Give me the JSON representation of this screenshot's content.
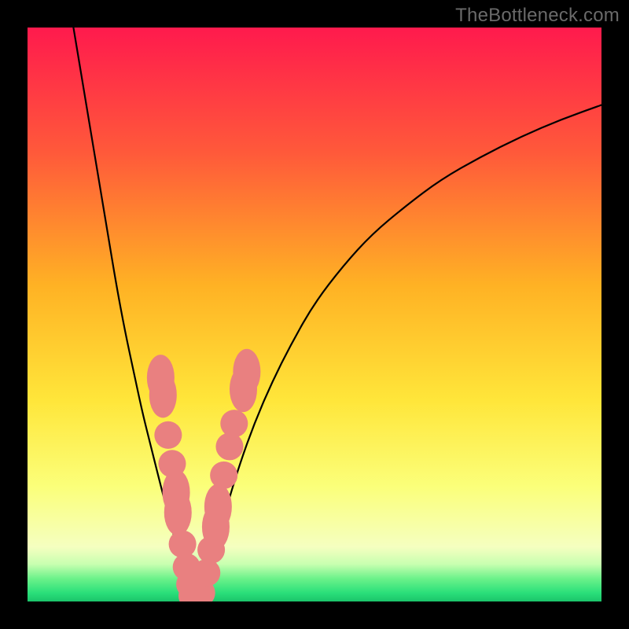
{
  "watermark": "TheBottleneck.com",
  "chart_data": {
    "type": "line",
    "title": "",
    "xlabel": "",
    "ylabel": "",
    "xlim": [
      0,
      100
    ],
    "ylim": [
      0,
      100
    ],
    "grid": false,
    "legend": false,
    "background_gradient_stops": [
      {
        "offset": 0.0,
        "color": "#ff1a4d"
      },
      {
        "offset": 0.22,
        "color": "#ff5a3a"
      },
      {
        "offset": 0.45,
        "color": "#ffb224"
      },
      {
        "offset": 0.65,
        "color": "#ffe63a"
      },
      {
        "offset": 0.8,
        "color": "#fbff7a"
      },
      {
        "offset": 0.905,
        "color": "#f5ffc0"
      },
      {
        "offset": 0.935,
        "color": "#c8ffb0"
      },
      {
        "offset": 0.96,
        "color": "#6cf28a"
      },
      {
        "offset": 0.985,
        "color": "#2adf7a"
      },
      {
        "offset": 1.0,
        "color": "#1bc46a"
      }
    ],
    "series": [
      {
        "name": "left-branch",
        "color": "#000000",
        "stroke_width": 2.2,
        "x": [
          8.0,
          9.5,
          11.0,
          12.5,
          14.0,
          15.5,
          17.0,
          18.5,
          20.0,
          21.5,
          23.0,
          24.3,
          25.5,
          26.5,
          27.3,
          28.0,
          28.7
        ],
        "y": [
          100,
          91.0,
          82.0,
          73.0,
          64.0,
          55.0,
          47.0,
          40.0,
          33.0,
          27.0,
          21.0,
          16.0,
          11.5,
          7.5,
          4.5,
          2.2,
          1.0
        ]
      },
      {
        "name": "right-branch",
        "color": "#000000",
        "stroke_width": 2.2,
        "x": [
          29.5,
          30.5,
          32.0,
          33.5,
          35.0,
          37.0,
          39.5,
          42.5,
          46.0,
          50.0,
          55.0,
          60.0,
          66.0,
          72.0,
          79.0,
          86.0,
          93.0,
          100.0
        ],
        "y": [
          1.0,
          3.0,
          7.0,
          12.0,
          17.5,
          24.0,
          31.0,
          38.0,
          45.0,
          52.0,
          58.5,
          64.0,
          69.0,
          73.5,
          77.5,
          81.0,
          84.0,
          86.5
        ]
      }
    ],
    "v_bottom": {
      "x_start": 28.7,
      "x_end": 29.5,
      "y": 1.0
    },
    "marker_groups": [
      {
        "name": "left-branch-markers",
        "color": "#e98080",
        "points": [
          {
            "x": 23.2,
            "y": 39.0,
            "rx": 2.4,
            "ry": 4.0
          },
          {
            "x": 23.6,
            "y": 36.0,
            "rx": 2.4,
            "ry": 4.0
          },
          {
            "x": 24.5,
            "y": 29.0,
            "rx": 2.4,
            "ry": 2.4
          },
          {
            "x": 25.2,
            "y": 24.0,
            "rx": 2.4,
            "ry": 2.4
          },
          {
            "x": 25.9,
            "y": 19.0,
            "rx": 2.4,
            "ry": 4.0
          },
          {
            "x": 26.2,
            "y": 15.5,
            "rx": 2.4,
            "ry": 4.0
          },
          {
            "x": 27.0,
            "y": 10.0,
            "rx": 2.4,
            "ry": 2.4
          },
          {
            "x": 27.7,
            "y": 6.0,
            "rx": 2.4,
            "ry": 2.4
          },
          {
            "x": 28.3,
            "y": 3.0,
            "rx": 2.4,
            "ry": 2.4
          }
        ]
      },
      {
        "name": "trough-markers",
        "color": "#e98080",
        "points": [
          {
            "x": 28.7,
            "y": 1.0,
            "rx": 2.4,
            "ry": 2.4
          },
          {
            "x": 29.5,
            "y": 1.0,
            "rx": 2.4,
            "ry": 2.4
          },
          {
            "x": 30.3,
            "y": 1.5,
            "rx": 2.4,
            "ry": 2.4
          }
        ]
      },
      {
        "name": "right-branch-markers",
        "color": "#e98080",
        "points": [
          {
            "x": 31.2,
            "y": 5.0,
            "rx": 2.4,
            "ry": 2.4
          },
          {
            "x": 32.0,
            "y": 9.0,
            "rx": 2.4,
            "ry": 2.4
          },
          {
            "x": 32.8,
            "y": 13.0,
            "rx": 2.4,
            "ry": 4.0
          },
          {
            "x": 33.2,
            "y": 16.5,
            "rx": 2.4,
            "ry": 4.0
          },
          {
            "x": 34.2,
            "y": 22.0,
            "rx": 2.4,
            "ry": 2.4
          },
          {
            "x": 35.2,
            "y": 27.0,
            "rx": 2.4,
            "ry": 2.4
          },
          {
            "x": 36.0,
            "y": 31.0,
            "rx": 2.4,
            "ry": 2.4
          },
          {
            "x": 37.6,
            "y": 37.0,
            "rx": 2.4,
            "ry": 4.0
          },
          {
            "x": 38.2,
            "y": 40.0,
            "rx": 2.4,
            "ry": 4.0
          }
        ]
      }
    ]
  }
}
